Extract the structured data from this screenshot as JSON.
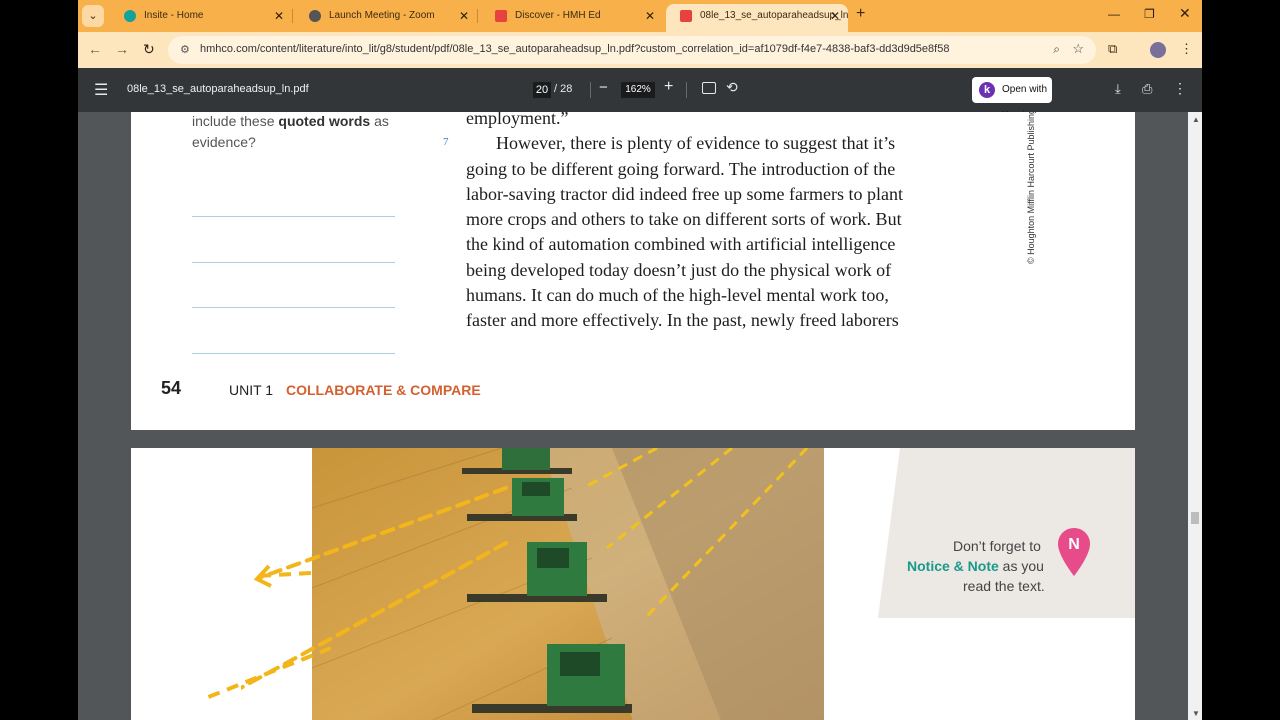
{
  "browser": {
    "tabs": [
      {
        "title": "Insite - Home",
        "active": false,
        "favicon_color": "#12a39a"
      },
      {
        "title": "Launch Meeting - Zoom",
        "active": false,
        "favicon_color": "#555555"
      },
      {
        "title": "Discover - HMH Ed",
        "active": false,
        "favicon_color": "#e8423f"
      },
      {
        "title": "08le_13_se_autoparaheadsup_ln",
        "active": true,
        "favicon_color": "#e8423f"
      }
    ],
    "tab_close_glyph": "✕",
    "new_tab_glyph": "+",
    "url": "hmhco.com/content/literature/into_lit/g8/student/pdf/08le_13_se_autoparaheadsup_ln.pdf?custom_correlation_id=af1079df-f4e7-4838-baf3-dd3d9d5e8f58",
    "accent_color": "#f7b04a"
  },
  "pdf_toolbar": {
    "file_name": "08le_13_se_autoparaheadsup_ln.pdf",
    "current_page": "20",
    "total_pages": "/ 28",
    "zoom": "162%",
    "kami_button": "Open with Kami",
    "kami_letter": "k"
  },
  "page_top": {
    "question_prefix": "include these ",
    "question_bold": "quoted words",
    "question_suffix": " as",
    "question_line2": "evidence?",
    "line_number": "7",
    "text_lines": [
      "employment.”",
      "However, there is plenty of evidence to suggest that it’s",
      "going to be different going forward. The introduction of the",
      "labor-saving tractor did indeed free up some farmers to plant",
      "more crops and others to take on different sorts of work. But",
      "the kind of automation combined with artificial intelligence",
      "being developed today doesn’t just do the physical work of",
      "humans. It can do much of the high-level mental work too,",
      "faster and more effectively. In the past, newly freed laborers"
    ],
    "copyright": "© Houghton Mifflin Harcourt Publishing C",
    "page_number": "54",
    "unit_label": "UNIT 1",
    "section_label": "COLLABORATE & COMPARE"
  },
  "page_next": {
    "notice_line1": "Don’t forget to",
    "notice_bold": "Notice & Note",
    "notice_line2_suffix": " as you",
    "notice_line3": "read the text.",
    "pin_letter": "N",
    "pin_color": "#e84b8a",
    "image_subject": "combine harvesters in a wheat field"
  }
}
